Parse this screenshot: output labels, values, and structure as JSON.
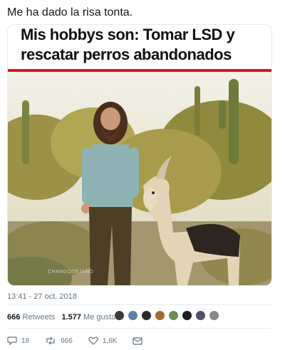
{
  "tweet": {
    "text": "Me ha dado la risa tonta."
  },
  "media": {
    "headline": "Mis hobbys son: Tomar LSD y rescatar perros abandonados",
    "watermark": "CHANGOTEJANO",
    "accent_color": "#d8171f"
  },
  "meta": {
    "timestamp": "13:41 - 27 oct. 2018"
  },
  "stats": {
    "retweets_count": "666",
    "retweets_label": "Retweets",
    "likes_count": "1.577",
    "likes_label": "Me gusta"
  },
  "avatars": [
    "#3b3b3b",
    "#5b7fa6",
    "#2a2a2a",
    "#a5682f",
    "#6a8d5a",
    "#1e1e1e",
    "#4f4f6a",
    "#888888"
  ],
  "actions": {
    "reply_count": "18",
    "retweet_count": "666",
    "like_count": "1,6K"
  },
  "icons": {
    "reply": "reply-icon",
    "retweet": "retweet-icon",
    "like": "heart-icon",
    "message": "direct-message-icon"
  }
}
